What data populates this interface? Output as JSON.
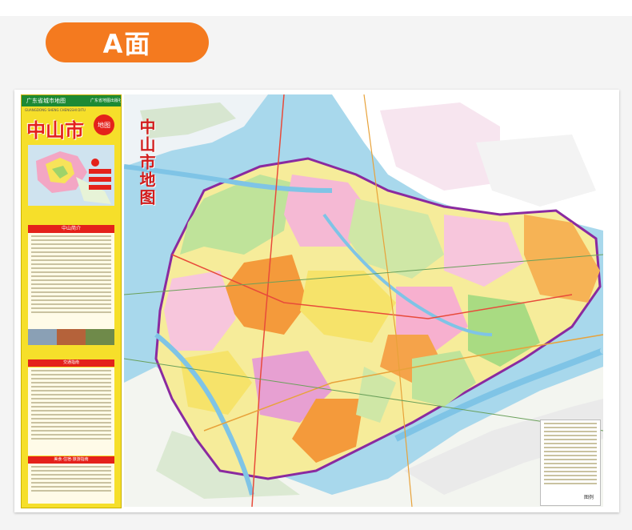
{
  "header": {
    "label": "A面"
  },
  "cover": {
    "series": "广东省城市地图",
    "publisher": "广东省地图出版社",
    "subtitle": "GUANGDONG SHENG CHENGSHI DITU",
    "title": "中山市",
    "badge": "地图",
    "intro_title": "中山简介",
    "section1_title": "交通指南",
    "section2_title": "美食·住宿·旅游指南"
  },
  "map": {
    "title": "中山市地图",
    "scale_label": "图例"
  },
  "colors": {
    "accent": "#f47a1f",
    "cover_bg": "#f6df2a",
    "map_water": "#a8d8ec",
    "boundary": "#8a2aa0"
  }
}
